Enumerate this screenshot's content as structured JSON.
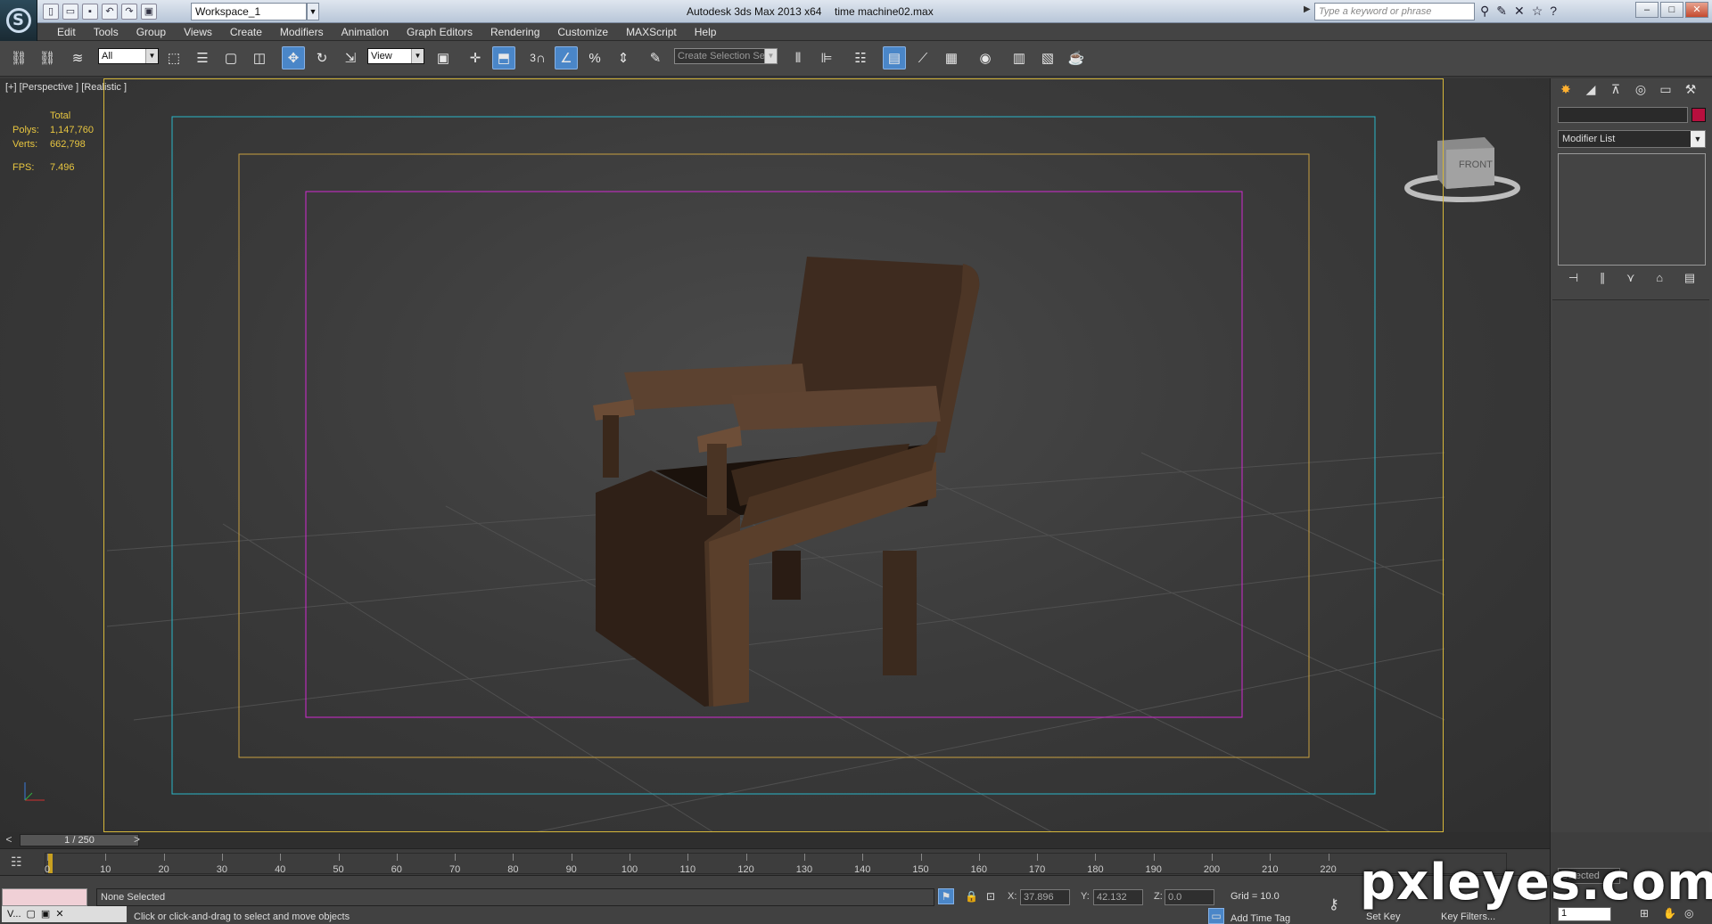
{
  "app": {
    "title": "Autodesk 3ds Max  2013 x64",
    "file": "time machine02.max",
    "workspace": "Workspace_1",
    "search_placeholder": "Type a keyword or phrase"
  },
  "menu": [
    "Edit",
    "Tools",
    "Group",
    "Views",
    "Create",
    "Modifiers",
    "Animation",
    "Graph Editors",
    "Rendering",
    "Customize",
    "MAXScript",
    "Help"
  ],
  "toolbar": {
    "selection_filter": "All",
    "ref_coord": "View",
    "named_selection": "Create Selection Se",
    "snap_value": "3"
  },
  "viewport": {
    "label": "[+] [Perspective ] [Realistic ]",
    "stats": {
      "header": "Total",
      "polys_label": "Polys:",
      "polys": "1,147,760",
      "verts_label": "Verts:",
      "verts": "662,798",
      "fps_label": "FPS:",
      "fps": "7.496"
    },
    "viewcube_label": "FRONT",
    "colors": {
      "safe_outer": "#2ab5c8",
      "safe_mid": "#c8a040",
      "safe_inner": "#d02ad0",
      "active_border": "#d6b73a"
    }
  },
  "command_panel": {
    "modifier_list": "Modifier List",
    "object_color": "#b80f3e"
  },
  "timeline": {
    "slider": "1 / 250",
    "ticks": [
      "0",
      "10",
      "20",
      "30",
      "40",
      "50",
      "60",
      "70",
      "80",
      "90",
      "100",
      "110",
      "120",
      "130",
      "140",
      "150",
      "160",
      "170",
      "180",
      "190",
      "200",
      "210",
      "220"
    ]
  },
  "status": {
    "selection": "None Selected",
    "hint": "Click or click-and-drag to select and move objects",
    "x_label": "X:",
    "x": "37.896",
    "y_label": "Y:",
    "y": "42.132",
    "z_label": "Z:",
    "z": "0.0",
    "grid": "Grid = 10.0",
    "add_time_tag": "Add Time Tag",
    "set_key": "Set Key",
    "key_filters": "Key Filters...",
    "frame": "1",
    "key_mode": "Selected",
    "mini_tab": "V..."
  },
  "watermark": "pxleyes.com"
}
